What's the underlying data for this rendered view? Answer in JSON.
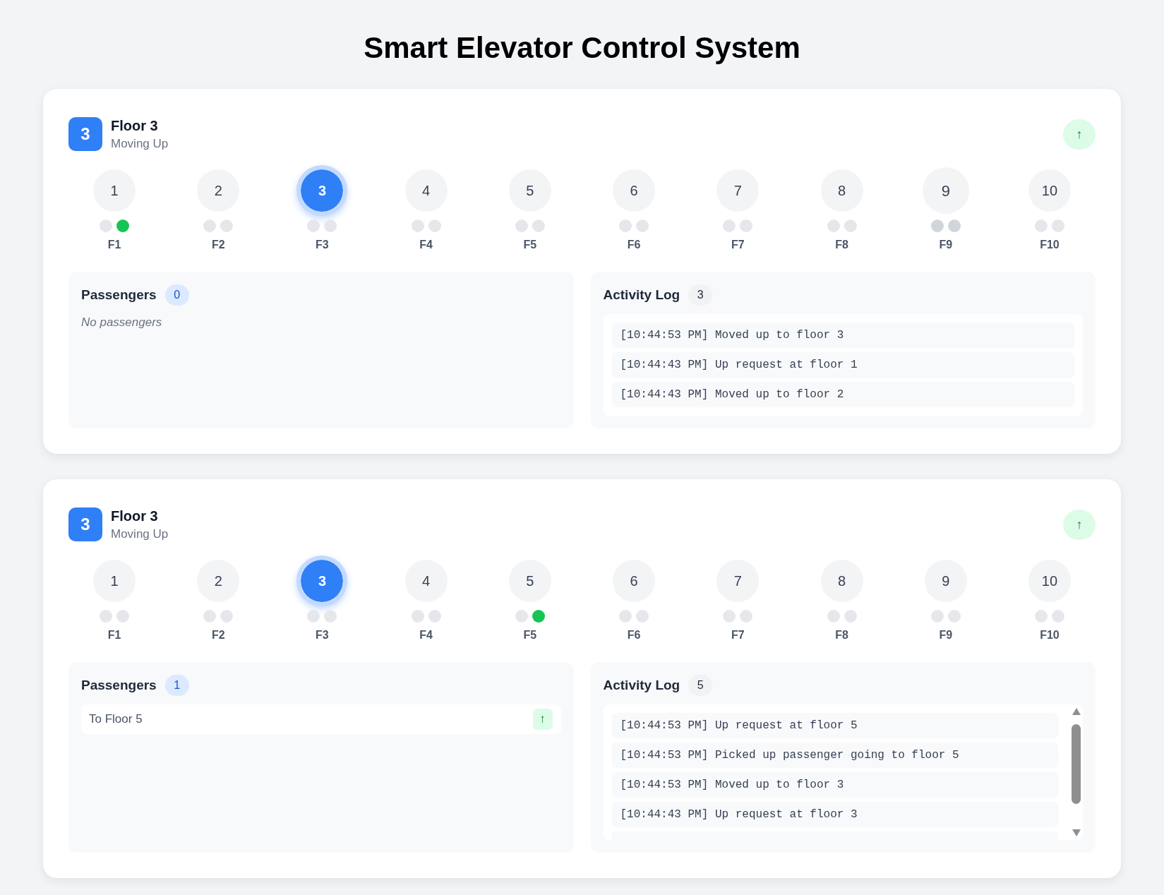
{
  "title": "Smart Elevator Control System",
  "elevators": [
    {
      "floor_badge": "3",
      "floor_label": "Floor 3",
      "status": "Moving Up",
      "direction_icon": "↑",
      "floors": [
        {
          "number": "1",
          "label": "F1",
          "selected": false,
          "hovered": false,
          "lamps": [
            {
              "lit": false
            },
            {
              "lit": true
            }
          ]
        },
        {
          "number": "2",
          "label": "F2",
          "selected": false,
          "hovered": false,
          "lamps": [
            {
              "lit": false
            },
            {
              "lit": false
            }
          ]
        },
        {
          "number": "3",
          "label": "F3",
          "selected": true,
          "hovered": false,
          "lamps": [
            {
              "lit": false
            },
            {
              "lit": false
            }
          ]
        },
        {
          "number": "4",
          "label": "F4",
          "selected": false,
          "hovered": false,
          "lamps": [
            {
              "lit": false
            },
            {
              "lit": false
            }
          ]
        },
        {
          "number": "5",
          "label": "F5",
          "selected": false,
          "hovered": false,
          "lamps": [
            {
              "lit": false
            },
            {
              "lit": false
            }
          ]
        },
        {
          "number": "6",
          "label": "F6",
          "selected": false,
          "hovered": false,
          "lamps": [
            {
              "lit": false
            },
            {
              "lit": false
            }
          ]
        },
        {
          "number": "7",
          "label": "F7",
          "selected": false,
          "hovered": false,
          "lamps": [
            {
              "lit": false
            },
            {
              "lit": false
            }
          ]
        },
        {
          "number": "8",
          "label": "F8",
          "selected": false,
          "hovered": false,
          "lamps": [
            {
              "lit": false
            },
            {
              "lit": false
            }
          ]
        },
        {
          "number": "9",
          "label": "F9",
          "selected": false,
          "hovered": true,
          "lamps": [
            {
              "lit": false
            },
            {
              "lit": false
            }
          ]
        },
        {
          "number": "10",
          "label": "F10",
          "selected": false,
          "hovered": false,
          "lamps": [
            {
              "lit": false
            },
            {
              "lit": false
            }
          ]
        }
      ],
      "passengers": {
        "title": "Passengers",
        "count": "0",
        "empty_text": "No passengers"
      },
      "activity_log": {
        "title": "Activity Log",
        "count": "3",
        "entries": [
          "[10:44:53 PM] Moved up to floor 3",
          "[10:44:43 PM] Up request at floor 1",
          "[10:44:43 PM] Moved up to floor 2"
        ]
      }
    },
    {
      "floor_badge": "3",
      "floor_label": "Floor 3",
      "status": "Moving Up",
      "direction_icon": "↑",
      "floors": [
        {
          "number": "1",
          "label": "F1",
          "selected": false,
          "hovered": false,
          "lamps": [
            {
              "lit": false
            },
            {
              "lit": false
            }
          ]
        },
        {
          "number": "2",
          "label": "F2",
          "selected": false,
          "hovered": false,
          "lamps": [
            {
              "lit": false
            },
            {
              "lit": false
            }
          ]
        },
        {
          "number": "3",
          "label": "F3",
          "selected": true,
          "hovered": false,
          "lamps": [
            {
              "lit": false
            },
            {
              "lit": false
            }
          ]
        },
        {
          "number": "4",
          "label": "F4",
          "selected": false,
          "hovered": false,
          "lamps": [
            {
              "lit": false
            },
            {
              "lit": false
            }
          ]
        },
        {
          "number": "5",
          "label": "F5",
          "selected": false,
          "hovered": false,
          "lamps": [
            {
              "lit": false
            },
            {
              "lit": true
            }
          ]
        },
        {
          "number": "6",
          "label": "F6",
          "selected": false,
          "hovered": false,
          "lamps": [
            {
              "lit": false
            },
            {
              "lit": false
            }
          ]
        },
        {
          "number": "7",
          "label": "F7",
          "selected": false,
          "hovered": false,
          "lamps": [
            {
              "lit": false
            },
            {
              "lit": false
            }
          ]
        },
        {
          "number": "8",
          "label": "F8",
          "selected": false,
          "hovered": false,
          "lamps": [
            {
              "lit": false
            },
            {
              "lit": false
            }
          ]
        },
        {
          "number": "9",
          "label": "F9",
          "selected": false,
          "hovered": false,
          "lamps": [
            {
              "lit": false
            },
            {
              "lit": false
            }
          ]
        },
        {
          "number": "10",
          "label": "F10",
          "selected": false,
          "hovered": false,
          "lamps": [
            {
              "lit": false
            },
            {
              "lit": false
            }
          ]
        }
      ],
      "passengers": {
        "title": "Passengers",
        "count": "1",
        "items": [
          {
            "text": "To Floor 5",
            "direction": "↑"
          }
        ]
      },
      "activity_log": {
        "title": "Activity Log",
        "count": "5",
        "scrollable": true,
        "entries": [
          "[10:44:53 PM] Up request at floor 5",
          "[10:44:53 PM] Picked up passenger going to floor 5",
          "[10:44:53 PM] Moved up to floor 3",
          "[10:44:43 PM] Up request at floor 3"
        ]
      }
    }
  ]
}
